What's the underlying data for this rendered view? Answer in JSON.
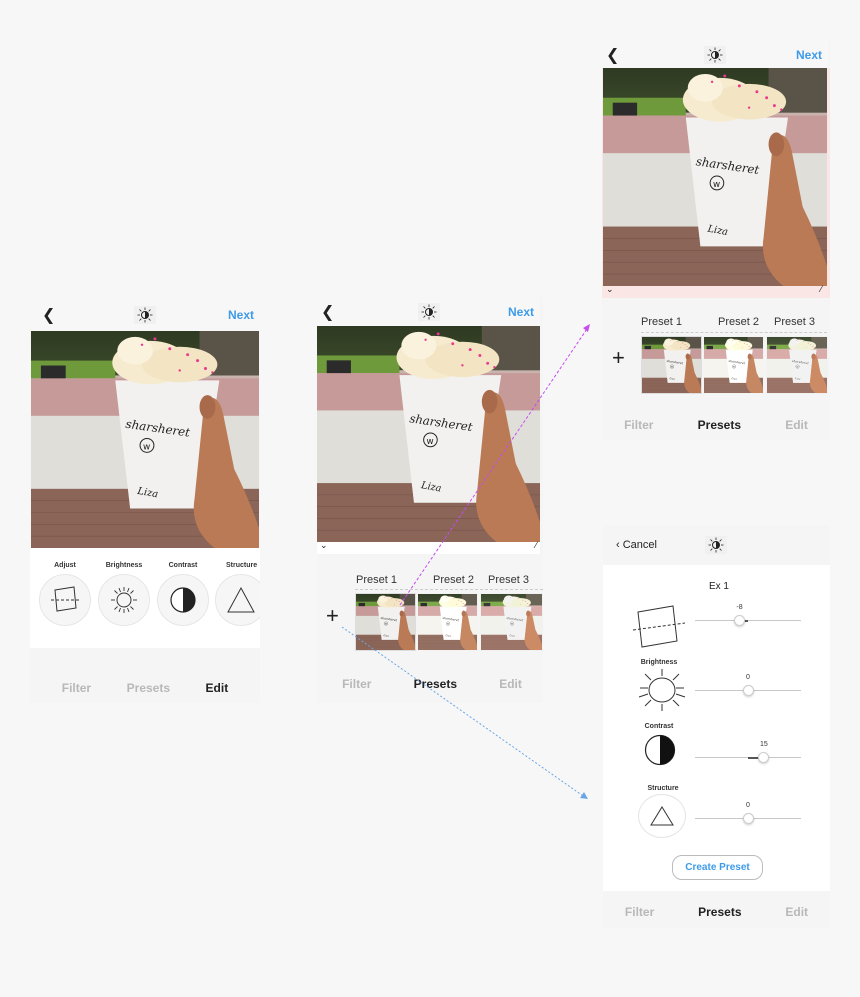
{
  "screen_edit": {
    "back_icon": "chevron-left-icon",
    "center_icon": "brightness-contrast-icon",
    "next_label": "Next",
    "tools": [
      {
        "label": "Adjust",
        "icon": "adjust-icon"
      },
      {
        "label": "Brightness",
        "icon": "sun-icon"
      },
      {
        "label": "Contrast",
        "icon": "contrast-icon"
      },
      {
        "label": "Structure",
        "icon": "triangle-icon"
      }
    ],
    "tabs": [
      {
        "label": "Filter",
        "active": false
      },
      {
        "label": "Presets",
        "active": false
      },
      {
        "label": "Edit",
        "active": true
      }
    ]
  },
  "screen_presets": {
    "next_label": "Next",
    "add_icon": "+",
    "presets": [
      {
        "label": "Preset 1"
      },
      {
        "label": "Preset 2"
      },
      {
        "label": "Preset 3"
      }
    ],
    "tabs": [
      {
        "label": "Filter",
        "active": false
      },
      {
        "label": "Presets",
        "active": true
      },
      {
        "label": "Edit",
        "active": false
      }
    ]
  },
  "screen_presets_zoom": {
    "next_label": "Next",
    "add_icon": "+",
    "presets": [
      {
        "label": "Preset 1"
      },
      {
        "label": "Preset 2"
      },
      {
        "label": "Preset 3"
      }
    ],
    "tabs": [
      {
        "label": "Filter",
        "active": false
      },
      {
        "label": "Presets",
        "active": true
      },
      {
        "label": "Edit",
        "active": false
      }
    ]
  },
  "screen_create_preset": {
    "cancel_label": "Cancel",
    "preset_name": "Ex 1",
    "adjustments": [
      {
        "label": "Adjust",
        "value": -8,
        "display": "-8"
      },
      {
        "label": "Brightness",
        "value": 0,
        "display": "0"
      },
      {
        "label": "Contrast",
        "value": 15,
        "display": "15"
      },
      {
        "label": "Structure",
        "value": 0,
        "display": "0"
      }
    ],
    "slider_range": [
      -50,
      50
    ],
    "create_label": "Create Preset",
    "tabs": [
      {
        "label": "Filter",
        "active": false
      },
      {
        "label": "Presets",
        "active": true
      },
      {
        "label": "Edit",
        "active": false
      }
    ]
  },
  "photo": {
    "cup_text": "sharsheret",
    "cup_logo": "W",
    "cup_name": "Liza"
  },
  "colors": {
    "accent": "#3d9be9",
    "arrow_purple": "#c64cf0",
    "arrow_blue": "#6aa6e6"
  }
}
